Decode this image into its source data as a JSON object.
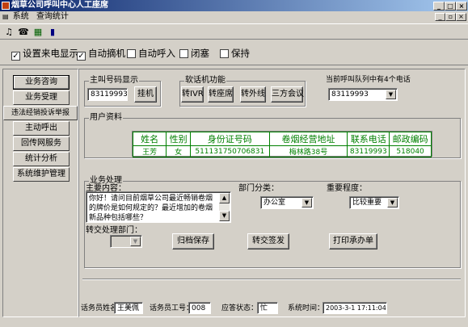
{
  "window": {
    "title": "烟草公司呼叫中心人工座席",
    "min_glyph": "_",
    "max_glyph": "□",
    "close_glyph": "×"
  },
  "menu": {
    "items": [
      "系统",
      "查询统计"
    ],
    "mdi_min": "_",
    "mdi_restore": "▫",
    "mdi_close": "×"
  },
  "toolbar": {
    "icons": [
      "bell-icon",
      "telephone-icon",
      "grid-icon",
      "bar-chart-icon"
    ],
    "glyphs": [
      "♫",
      "☎",
      "▦",
      "▮"
    ]
  },
  "options": {
    "caller_id": {
      "label": "设置来电显示",
      "checked": true
    },
    "auto_hangup": {
      "label": "自动摘机",
      "checked": true
    },
    "auto_call": {
      "label": "自动呼入",
      "checked": false
    },
    "block": {
      "label": "闭塞",
      "checked": false
    },
    "hold": {
      "label": "保持",
      "checked": false
    },
    "check_mark": "✓"
  },
  "sidebar": {
    "items": [
      {
        "label": "业务咨询"
      },
      {
        "label": "业务受理"
      },
      {
        "label": "违法经销投诉举报"
      },
      {
        "label": "主动呼出"
      },
      {
        "label": "回传网服务"
      },
      {
        "label": "统计分析"
      },
      {
        "label": "系统维护管理"
      }
    ]
  },
  "caller": {
    "group_label": "主叫号码显示",
    "number": "83119993",
    "hangup_label": "挂机"
  },
  "softphone": {
    "group_label": "软话机功能",
    "buttons": [
      "转IVR",
      "转座席",
      "转外线",
      "三方会议"
    ]
  },
  "queue": {
    "label": "当前呼叫队列中有4个电话",
    "selected": "83119993",
    "arrow": "▼"
  },
  "customer": {
    "group_label": "用户资料",
    "headers": [
      "姓名",
      "性别",
      "身份证号码",
      "卷烟经营地址",
      "联系电话",
      "邮政编码"
    ],
    "rows": [
      [
        "王芳",
        "女",
        "511131750706831",
        "梅林路38号",
        "83119993",
        "518040"
      ]
    ]
  },
  "business": {
    "group_label": "业务处理",
    "content_label": "主要内容：",
    "content_text": "你好！请问目前烟草公司最近畅销卷烟的牌价是如何规定的？最近增加的卷烟新品种包括哪些？",
    "category_label": "部门分类：",
    "category_value": "办公室",
    "importance_label": "重要程度：",
    "importance_value": "比较重要",
    "transfer_dept_label": "转交处理部门：",
    "transfer_dept_value": "",
    "archive_label": "归档保存",
    "transfer_label": "转交签发",
    "print_label": "打印承办单",
    "scroll_up": "▲",
    "scroll_down": "▼"
  },
  "status": {
    "operator_name_label": "话务员姓名",
    "operator_name": "王美佩",
    "operator_id_label": "话务员工号：",
    "operator_id": "008",
    "answer_state_label": "应答状态：",
    "answer_state": "忙",
    "system_time_label": "系统时间：",
    "system_time": "2003-3-1 17:11:04"
  }
}
